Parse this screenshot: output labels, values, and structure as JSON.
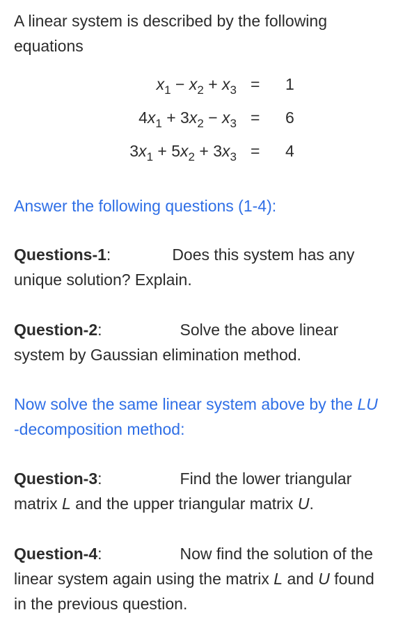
{
  "intro": "A linear system is described by the following equations",
  "equations": [
    {
      "lhs_terms": [
        {
          "coef": "",
          "var": "x",
          "sub": "1",
          "op_after": " − "
        },
        {
          "coef": "",
          "var": "x",
          "sub": "2",
          "op_after": " + "
        },
        {
          "coef": "",
          "var": "x",
          "sub": "3",
          "op_after": ""
        }
      ],
      "sign": "=",
      "rhs": "1"
    },
    {
      "lhs_terms": [
        {
          "coef": "4",
          "var": "x",
          "sub": "1",
          "op_after": " + "
        },
        {
          "coef": "3",
          "var": "x",
          "sub": "2",
          "op_after": " − "
        },
        {
          "coef": "",
          "var": "x",
          "sub": "3",
          "op_after": ""
        }
      ],
      "sign": "=",
      "rhs": "6"
    },
    {
      "lhs_terms": [
        {
          "coef": "3",
          "var": "x",
          "sub": "1",
          "op_after": " + "
        },
        {
          "coef": "5",
          "var": "x",
          "sub": "2",
          "op_after": " + "
        },
        {
          "coef": "3",
          "var": "x",
          "sub": "3",
          "op_after": ""
        }
      ],
      "sign": "=",
      "rhs": "4"
    }
  ],
  "answer_heading": "Answer the following questions (1-4):",
  "questions": [
    {
      "label": "Questions-1",
      "colon": ":",
      "text_first": "Does this system has any",
      "text_rest": "unique solution? Explain."
    },
    {
      "label": "Question-2",
      "colon": ":",
      "text_first": "Solve the above linear",
      "text_rest": "system by Gaussian elimination method."
    },
    {
      "label": "Question-3",
      "colon": ":",
      "text_first": "Find the lower triangular",
      "text_rest_parts": [
        "matrix ",
        "L",
        " and the upper triangular matrix ",
        "U",
        "."
      ]
    },
    {
      "label": "Question-4",
      "colon": ":",
      "text_first": "Now find the solution of the",
      "text_rest_parts": [
        "linear system again using the matrix ",
        "L",
        " and ",
        "U",
        " found"
      ],
      "text_last": "in the previous question."
    }
  ],
  "lu_heading": {
    "line1_prefix": "Now solve the same linear system above by the ",
    "line1_italic": "LU",
    "line2": "-decomposition method:"
  },
  "colors": {
    "text": "#2b2b2b",
    "accent_blue": "#2f6fe6",
    "background": "#ffffff"
  }
}
